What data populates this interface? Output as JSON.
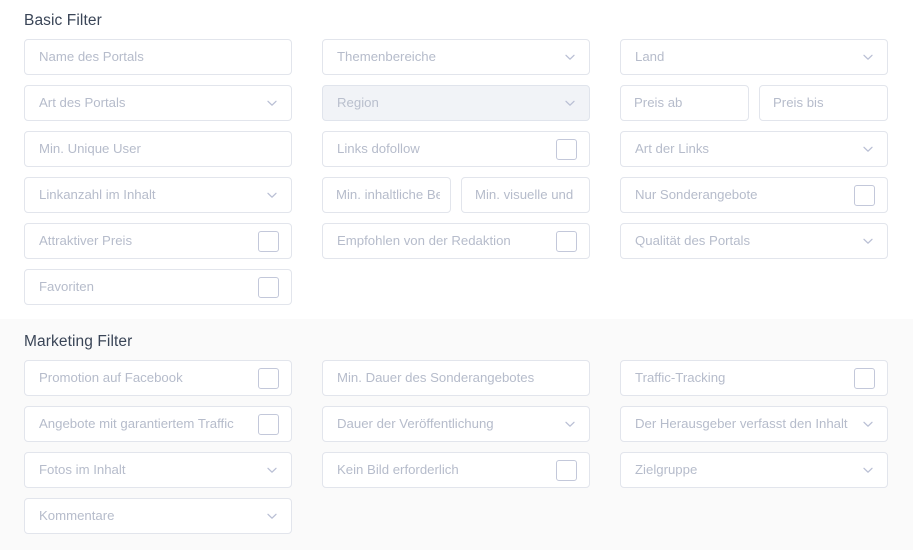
{
  "sections": [
    {
      "id": "basic",
      "title": "Basic Filter",
      "rows": [
        {
          "cells": [
            {
              "kind": "text",
              "label": "Name des Portals",
              "name": "field-name-des-portals"
            },
            {
              "kind": "select",
              "label": "Themenbereiche",
              "name": "field-themenbereiche"
            },
            {
              "kind": "select",
              "label": "Land",
              "name": "field-land"
            }
          ]
        },
        {
          "cells": [
            {
              "kind": "select",
              "label": "Art des Portals",
              "name": "field-art-des-portals"
            },
            {
              "kind": "select",
              "label": "Region",
              "name": "field-region",
              "disabled": true
            },
            {
              "kind": "split",
              "name": "field-preis-range",
              "parts": [
                {
                  "label": "Preis ab",
                  "name": "field-preis-ab"
                },
                {
                  "label": "Preis bis",
                  "name": "field-preis-bis"
                }
              ]
            }
          ]
        },
        {
          "cells": [
            {
              "kind": "text",
              "label": "Min. Unique User",
              "name": "field-min-unique-user"
            },
            {
              "kind": "checkbox",
              "label": "Links dofollow",
              "name": "field-links-dofollow"
            },
            {
              "kind": "select",
              "label": "Art der Links",
              "name": "field-art-der-links"
            }
          ]
        },
        {
          "cells": [
            {
              "kind": "select",
              "label": "Linkanzahl im Inhalt",
              "name": "field-linkanzahl-im-inhalt"
            },
            {
              "kind": "split",
              "name": "field-min-laenge-range",
              "parts": [
                {
                  "label": "Min. inhaltliche Be",
                  "name": "field-min-inhaltliche-beschreibung"
                },
                {
                  "label": "Min. visuelle und",
                  "name": "field-min-visuelle-und"
                }
              ]
            },
            {
              "kind": "checkbox",
              "label": "Nur Sonderangebote",
              "name": "field-nur-sonderangebote"
            }
          ]
        },
        {
          "cells": [
            {
              "kind": "checkbox",
              "label": "Attraktiver Preis",
              "name": "field-attraktiver-preis"
            },
            {
              "kind": "checkbox",
              "label": "Empfohlen von der Redaktion",
              "name": "field-empfohlen-von-der-redaktion"
            },
            {
              "kind": "select",
              "label": "Qualität des Portals",
              "name": "field-qualitaet-des-portals"
            }
          ]
        },
        {
          "cells": [
            {
              "kind": "checkbox",
              "label": "Favoriten",
              "name": "field-favoriten"
            },
            {
              "kind": "empty",
              "name": "grid-spacer"
            },
            {
              "kind": "empty",
              "name": "grid-spacer"
            }
          ]
        }
      ]
    },
    {
      "id": "marketing",
      "title": "Marketing Filter",
      "rows": [
        {
          "cells": [
            {
              "kind": "checkbox",
              "label": "Promotion auf Facebook",
              "name": "field-promotion-auf-facebook"
            },
            {
              "kind": "text",
              "label": "Min. Dauer des Sonderangebotes",
              "name": "field-min-dauer-des-sonderangebotes"
            },
            {
              "kind": "checkbox",
              "label": "Traffic-Tracking",
              "name": "field-traffic-tracking"
            }
          ]
        },
        {
          "cells": [
            {
              "kind": "checkbox",
              "label": "Angebote mit garantiertem Traffic",
              "name": "field-angebote-mit-garantiertem-traffic"
            },
            {
              "kind": "select",
              "label": "Dauer der Veröffentlichung",
              "name": "field-dauer-der-veroeffentlichung"
            },
            {
              "kind": "select",
              "label": "Der Herausgeber verfasst den Inhalt",
              "name": "field-der-herausgeber-verfasst-den-inhalt"
            }
          ]
        },
        {
          "cells": [
            {
              "kind": "select",
              "label": "Fotos im Inhalt",
              "name": "field-fotos-im-inhalt"
            },
            {
              "kind": "checkbox",
              "label": "Kein Bild erforderlich",
              "name": "field-kein-bild-erforderlich"
            },
            {
              "kind": "select",
              "label": "Zielgruppe",
              "name": "field-zielgruppe"
            }
          ]
        },
        {
          "cells": [
            {
              "kind": "select",
              "label": "Kommentare",
              "name": "field-kommentare"
            },
            {
              "kind": "empty",
              "name": "grid-spacer"
            },
            {
              "kind": "empty",
              "name": "grid-spacer"
            }
          ]
        }
      ]
    }
  ],
  "icons": {
    "chevron": "chevron-down-icon",
    "checkbox": "checkbox-icon"
  },
  "colors": {
    "border": "#e2e5ec",
    "placeholder": "#b6bccb",
    "heading": "#3a4557",
    "disabled_fill": "#f1f3f7",
    "section_bg": "#fafafa",
    "checkbox_border": "#c3c8da",
    "chevron": "#b9bfd4"
  }
}
